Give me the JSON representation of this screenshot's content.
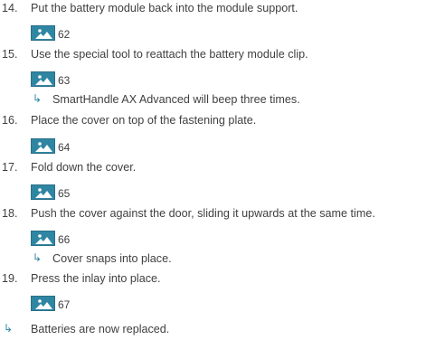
{
  "steps": [
    {
      "num": "14.",
      "text": "Put the battery module back into the module support.",
      "figure": "62"
    },
    {
      "num": "15.",
      "text": "Use the special tool to reattach the battery module clip.",
      "figure": "63",
      "result": "SmartHandle AX Advanced will beep three times."
    },
    {
      "num": "16.",
      "text": "Place the cover on top of the fastening plate.",
      "figure": "64"
    },
    {
      "num": "17.",
      "text": "Fold down the cover.",
      "figure": "65"
    },
    {
      "num": "18.",
      "text": "Push the cover against the door, sliding it upwards at the same time.",
      "figure": "66",
      "result": "Cover snaps into place."
    },
    {
      "num": "19.",
      "text": "Press the inlay into place.",
      "figure": "67"
    }
  ],
  "final_result": "Batteries are now replaced.",
  "icons": {
    "image": "image-placeholder-icon",
    "result_arrow": "result-arrow-icon"
  },
  "colors": {
    "accent": "#2f86a3",
    "text": "#3f3f3f"
  }
}
